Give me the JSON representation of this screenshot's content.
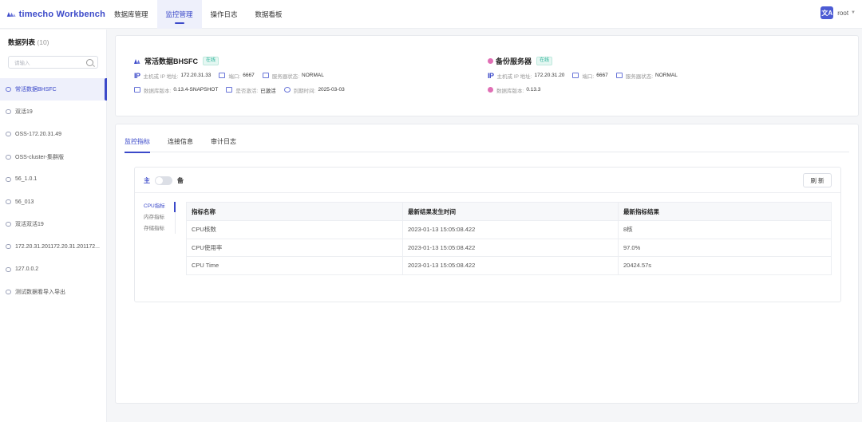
{
  "app": {
    "logo_text": "timecho Workbench"
  },
  "nav": {
    "items": [
      {
        "label": "数据库管理",
        "active": false
      },
      {
        "label": "监控管理",
        "active": true
      },
      {
        "label": "操作日志",
        "active": false
      },
      {
        "label": "数据看板",
        "active": false
      }
    ]
  },
  "user": {
    "avatar_text": "文A",
    "name": "root"
  },
  "sidebar": {
    "title": "数据列表",
    "count": "(10)",
    "search_placeholder": "请输入",
    "items": [
      {
        "label": "常活数据BHSFC",
        "active": true
      },
      {
        "label": "双活19",
        "active": false
      },
      {
        "label": "OSS-172.20.31.49",
        "active": false
      },
      {
        "label": "OSS-cluster-集群版",
        "active": false
      },
      {
        "label": "56_1.0.1",
        "active": false
      },
      {
        "label": "56_013",
        "active": false
      },
      {
        "label": "双活双活19",
        "active": false
      },
      {
        "label": "172.20.31.201172.20.31.201172...",
        "active": false
      },
      {
        "label": "127.0.0.2",
        "active": false
      },
      {
        "label": "测试数据看导入导出",
        "active": false
      }
    ]
  },
  "primary": {
    "name": "常活数据BHSFC",
    "status": "在线",
    "ip_tag": "IP",
    "ip_key": "主机或 IP 地址:",
    "ip_val": "172.20.31.33",
    "port_key": "端口:",
    "port_val": "6667",
    "state_key": "服务器状态:",
    "state_val": "NORMAL",
    "version_key": "数据库版本:",
    "version_val": "0.13.4-SNAPSHOT",
    "activated_key": "是否激活:",
    "activated_val": "已激活",
    "expire_key": "到期时间:",
    "expire_val": "2025-03-03"
  },
  "backup": {
    "name": "备份服务器",
    "status": "在线",
    "ip_tag": "IP",
    "ip_key": "主机或 IP 地址:",
    "ip_val": "172.20.31.20",
    "port_key": "端口:",
    "port_val": "6667",
    "state_key": "服务器状态:",
    "state_val": "NORMAL",
    "version_key": "数据库版本:",
    "version_val": "0.13.3"
  },
  "tabs": [
    {
      "label": "监控指标",
      "active": true
    },
    {
      "label": "连接信息",
      "active": false
    },
    {
      "label": "审计日志",
      "active": false
    }
  ],
  "switch": {
    "primary_label": "主",
    "backup_label": "备"
  },
  "refresh_label": "刷 新",
  "metric_tabs": [
    {
      "label": "CPU指标",
      "active": true
    },
    {
      "label": "内存指标",
      "active": false
    },
    {
      "label": "存储指标",
      "active": false
    }
  ],
  "table": {
    "headers": [
      "指标名称",
      "最新结果发生时间",
      "最新指标结果"
    ],
    "rows": [
      [
        "CPU核数",
        "2023-01-13 15:05:08.422",
        "8核"
      ],
      [
        "CPU使用率",
        "2023-01-13 15:05:08.422",
        "97.0%"
      ],
      [
        "CPU Time",
        "2023-01-13 15:05:08.422",
        "20424.57s"
      ]
    ]
  },
  "colors": {
    "accent": "#3b49c9",
    "online": "#29b39a",
    "backup_dot": "#e06fb5"
  },
  "icons": [
    "logo-icon",
    "search-icon",
    "database-icon",
    "port-icon",
    "server-status-icon",
    "version-icon",
    "activation-icon",
    "clock-icon",
    "translate-icon",
    "chevron-down-icon"
  ]
}
